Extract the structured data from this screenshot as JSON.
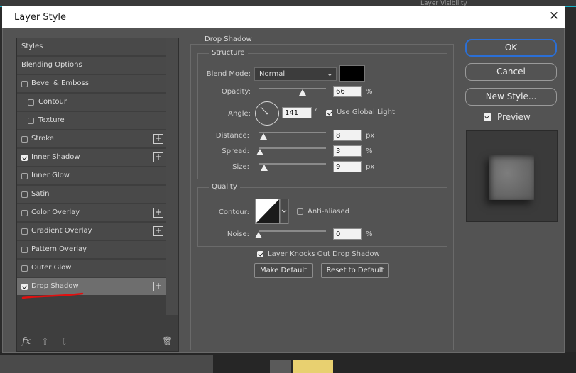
{
  "background_panel": {
    "text": "Layer Visibility"
  },
  "dialog": {
    "title": "Layer Style",
    "close_glyph": "✕"
  },
  "styles_list": {
    "header": "Styles",
    "blending": "Blending Options",
    "items": [
      {
        "label": "Bevel & Emboss",
        "checked": false,
        "plus": false
      },
      {
        "label": "Contour",
        "checked": false,
        "plus": false
      },
      {
        "label": "Texture",
        "checked": false,
        "plus": false
      },
      {
        "label": "Stroke",
        "checked": false,
        "plus": true
      },
      {
        "label": "Inner Shadow",
        "checked": true,
        "plus": true
      },
      {
        "label": "Inner Glow",
        "checked": false,
        "plus": false
      },
      {
        "label": "Satin",
        "checked": false,
        "plus": false
      },
      {
        "label": "Color Overlay",
        "checked": false,
        "plus": true
      },
      {
        "label": "Gradient Overlay",
        "checked": false,
        "plus": true
      },
      {
        "label": "Pattern Overlay",
        "checked": false,
        "plus": false
      },
      {
        "label": "Outer Glow",
        "checked": false,
        "plus": false
      },
      {
        "label": "Drop Shadow",
        "checked": true,
        "plus": true,
        "selected": true
      }
    ],
    "footer": {
      "fx": "fx",
      "up": "⇧",
      "down": "⇩",
      "trash": "🗑"
    }
  },
  "drop_shadow": {
    "group_title": "Drop Shadow",
    "structure": {
      "title": "Structure",
      "blend_mode_label": "Blend Mode:",
      "blend_mode_value": "Normal",
      "shadow_color": "#000000",
      "opacity_label": "Opacity:",
      "opacity_value": "66",
      "opacity_unit": "%",
      "angle_label": "Angle:",
      "angle_value": "141",
      "angle_unit": "°",
      "use_global_light_label": "Use Global Light",
      "use_global_light": true,
      "distance_label": "Distance:",
      "distance_value": "8",
      "distance_unit": "px",
      "spread_label": "Spread:",
      "spread_value": "3",
      "spread_unit": "%",
      "size_label": "Size:",
      "size_value": "9",
      "size_unit": "px"
    },
    "quality": {
      "title": "Quality",
      "contour_label": "Contour:",
      "anti_aliased_label": "Anti-aliased",
      "anti_aliased": false,
      "noise_label": "Noise:",
      "noise_value": "0",
      "noise_unit": "%"
    },
    "knocks_out_label": "Layer Knocks Out Drop Shadow",
    "knocks_out": true,
    "make_default": "Make Default",
    "reset_default": "Reset to Default"
  },
  "actions": {
    "ok": "OK",
    "cancel": "Cancel",
    "new_style": "New Style...",
    "preview_label": "Preview",
    "preview": true
  },
  "colors": {
    "accent": "#2b6fd6",
    "annotation": "#e01010"
  }
}
